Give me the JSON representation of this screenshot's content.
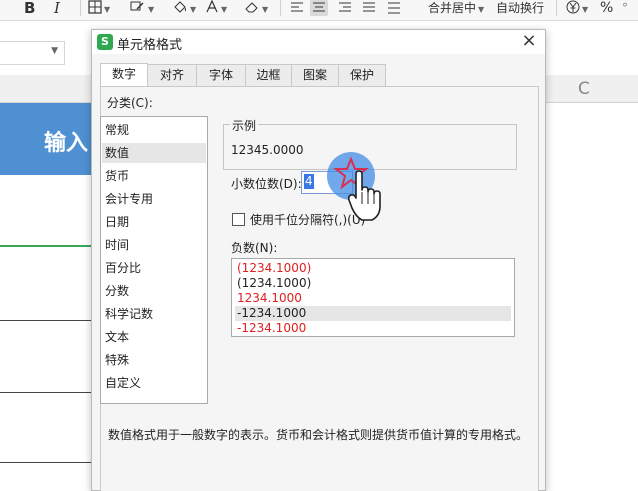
{
  "toolbar": {
    "bold": "B",
    "italic": "I",
    "merge_center": "合并居中",
    "wrap_text": "自动换行",
    "percent": "%"
  },
  "sheet": {
    "column_c": "C",
    "banner_text": "输入",
    "banner_color": "#4f90d2"
  },
  "dialog": {
    "title": "单元格格式",
    "app_icon_letter": "S",
    "close_glyph": "×",
    "tabs": [
      {
        "label": "数字",
        "active": true
      },
      {
        "label": "对齐",
        "active": false
      },
      {
        "label": "字体",
        "active": false
      },
      {
        "label": "边框",
        "active": false
      },
      {
        "label": "图案",
        "active": false
      },
      {
        "label": "保护",
        "active": false
      }
    ],
    "category_label": "分类(C):",
    "categories": [
      "常规",
      "数值",
      "货币",
      "会计专用",
      "日期",
      "时间",
      "百分比",
      "分数",
      "科学记数",
      "文本",
      "特殊",
      "自定义"
    ],
    "selected_category": "数值",
    "sample_label": "示例",
    "sample_value": "12345.0000",
    "decimal_places_label": "小数位数(D):",
    "decimal_places_value": "4",
    "thousands_separator_label": "使用千位分隔符(,)(U)",
    "thousands_separator_checked": false,
    "negative_label": "负数(N):",
    "negative_formats": [
      {
        "text": "(1234.1000)",
        "color": "#e02020"
      },
      {
        "text": "(1234.1000)",
        "color": "#222222"
      },
      {
        "text": "1234.1000",
        "color": "#e02020"
      },
      {
        "text": "-1234.1000",
        "color": "#222222",
        "selected": true
      },
      {
        "text": "-1234.1000",
        "color": "#e02020"
      }
    ],
    "description": "数值格式用于一般数字的表示。货币和会计格式则提供货币值计算的专用格式。"
  }
}
